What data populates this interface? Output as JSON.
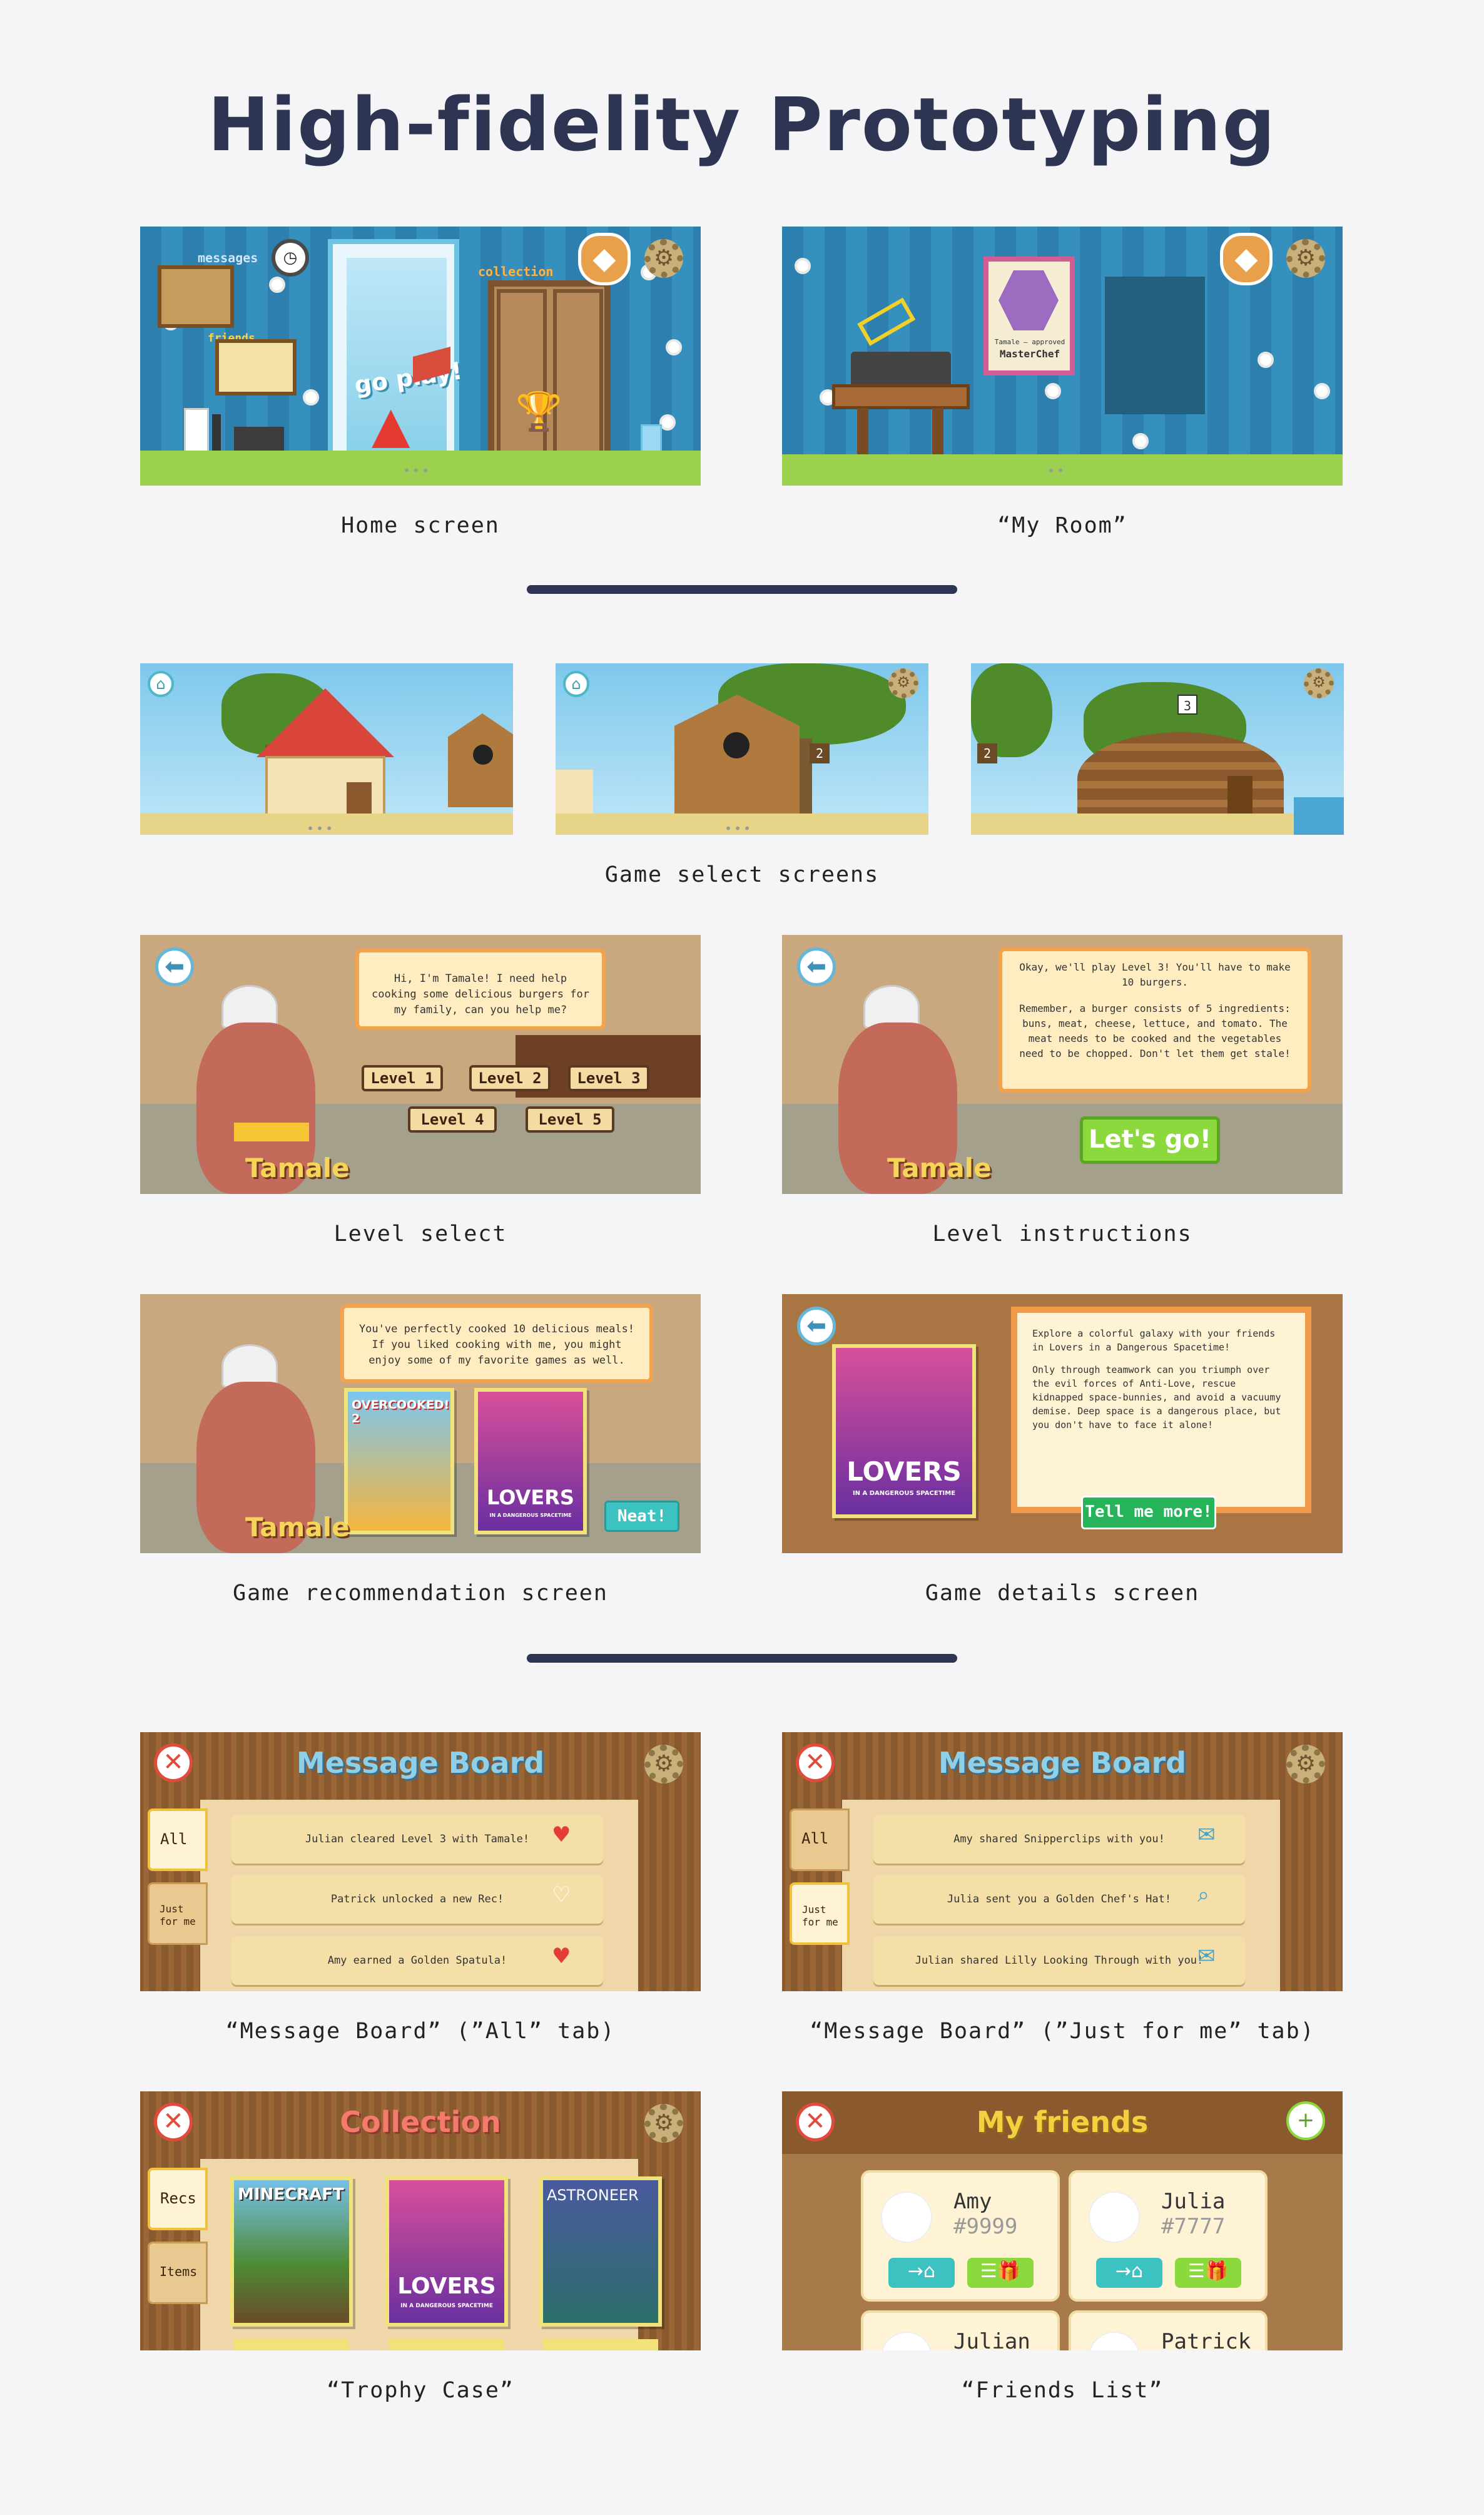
{
  "title": "High-fidelity Prototyping",
  "colors": {
    "navy": "#2e3553",
    "teal": "#3cc2c0",
    "green": "#8bd93d",
    "orange": "#f4a24c",
    "wood": "#8a5a2e"
  },
  "section1": {
    "home": {
      "caption": "Home screen",
      "messages_label": "messages",
      "friends_label": "friends",
      "collection_label": "collection",
      "go_play": "go play!",
      "pager": "•••"
    },
    "room": {
      "caption": "“My Room”",
      "poster_line1": "Tamale – approved",
      "poster_line2": "MasterChef",
      "pager": "••"
    }
  },
  "section2": {
    "game_select": {
      "caption": "Game select screens",
      "badge_2": "2",
      "badge_3": "3",
      "pager": "•••"
    },
    "level_select": {
      "caption": "Level select",
      "bubble": "Hi, I'm Tamale! I need help cooking some delicious burgers for my family, can you help me?",
      "levels": [
        "Level 1",
        "Level 2",
        "Level 3",
        "Level 4",
        "Level 5"
      ],
      "name": "Tamale"
    },
    "level_instructions": {
      "caption": "Level instructions",
      "bubble_p1": "Okay, we'll play Level 3! You'll have to make 10 burgers.",
      "bubble_p2": "Remember, a burger consists of 5 ingredients: buns, meat, cheese, lettuce, and tomato. The meat needs to be cooked and the vegetables need to be chopped. Don't let them get stale!",
      "button": "Let's go!",
      "name": "Tamale"
    },
    "recommendation": {
      "caption": "Game recommendation screen",
      "bubble": "You've perfectly cooked 10 delicious meals! If you liked cooking with me, you might enjoy some of my favorite games as well.",
      "cover1": "OVERCOOKED! 2",
      "cover2": "LOVERS",
      "cover2_sub": "IN A DANGEROUS SPACETIME",
      "button": "Neat!",
      "name": "Tamale"
    },
    "details": {
      "caption": "Game details screen",
      "cover": "LOVERS",
      "cover_sub": "IN A DANGEROUS SPACETIME",
      "text_p1": "Explore a colorful galaxy with your friends in Lovers in a Dangerous Spacetime!",
      "text_p2": "Only through teamwork can you triumph over the evil forces of Anti-Love, rescue kidnapped space-bunnies, and avoid a vacuumy demise. Deep space is a dangerous place, but you don't have to face it alone!",
      "button": "Tell me more!"
    }
  },
  "section3": {
    "board_all": {
      "caption": "“Message Board” (”All” tab)",
      "title": "Message Board",
      "tab_all": "All",
      "tab_me": "Just for me",
      "messages": [
        "Julian cleared Level 3 with Tamale!",
        "Patrick unlocked a new Rec!",
        "Amy earned a Golden Spatula!"
      ]
    },
    "board_me": {
      "caption": "“Message Board” (”Just for me” tab)",
      "title": "Message Board",
      "tab_all": "All",
      "tab_me": "Just for me",
      "messages": [
        "Amy shared Snipperclips with you!",
        "Julia sent you a Golden Chef's Hat!",
        "Julian shared Lilly Looking Through with you!"
      ]
    },
    "trophy": {
      "caption": "“Trophy Case”",
      "title": "Collection",
      "tab_recs": "Recs",
      "tab_items": "Items",
      "covers": [
        "MINECRAFT",
        "LOVERS",
        "ASTRONEER"
      ],
      "cover2_sub": "IN A DANGEROUS SPACETIME"
    },
    "friends": {
      "caption": "“Friends List”",
      "title": "My friends",
      "list": [
        {
          "name": "Amy",
          "code": "#9999"
        },
        {
          "name": "Julia",
          "code": "#7777"
        },
        {
          "name": "Julian",
          "code": ""
        },
        {
          "name": "Patrick",
          "code": ""
        }
      ]
    }
  }
}
